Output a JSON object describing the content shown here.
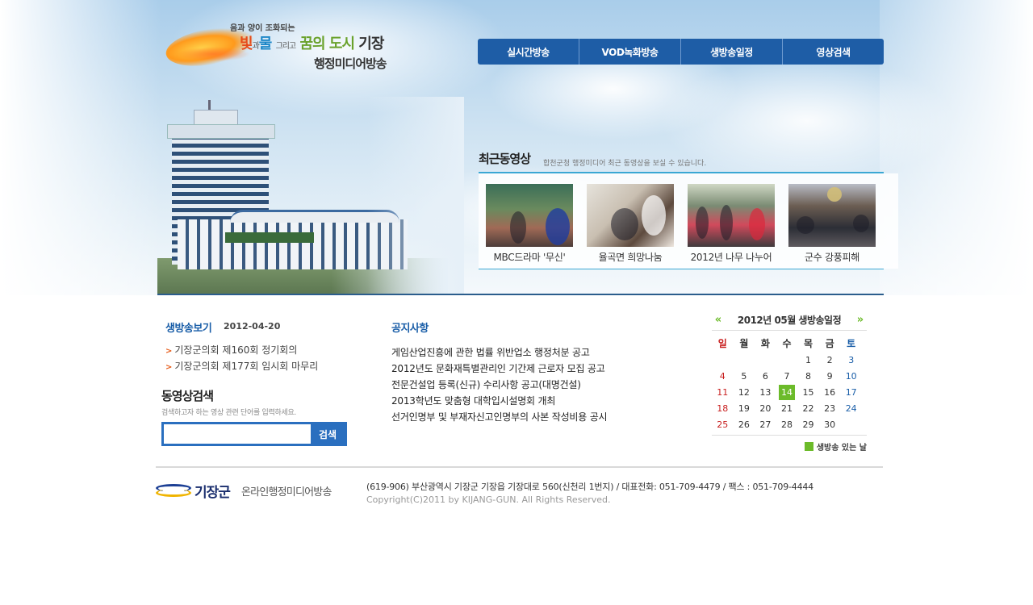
{
  "logo": {
    "tagline": "음과 양이 조화되는",
    "title_part1": "빛",
    "title_part2": "과",
    "title_part3": "물",
    "title_part4": "그리고",
    "title_part5": "꿈의 도시",
    "title_part6": "기장",
    "subtitle": "행정미디어방송"
  },
  "topnav": {
    "items": [
      "실시간방송",
      "VOD녹화방송",
      "생방송일정",
      "영상검색"
    ]
  },
  "recent": {
    "title": "최근동영상",
    "description": "합천군청 행정미디어 최근 동영상을 보실 수 있습니다.",
    "videos": [
      {
        "caption": "MBC드라마 '무신'"
      },
      {
        "caption": "율곡면 희망나눔"
      },
      {
        "caption": "2012년 나무 나누어"
      },
      {
        "caption": "군수 강풍피해"
      }
    ]
  },
  "live": {
    "title": "생방송보기",
    "date": "2012-04-20",
    "items": [
      "기장군의회 제160회 정기회의",
      "기장군의회 제177회 임시회 마무리"
    ]
  },
  "search": {
    "title": "동영상검색",
    "description": "검색하고자 하는 영상 관련 단어를 입력하세요.",
    "input_value": "",
    "button_label": "검색"
  },
  "notice": {
    "title": "공지사항",
    "items": [
      "게임산업진흥에 관한 법률 위반업소 행정처분 공고",
      "2012년도 문화재특별관리인 기간제 근로자 모집 공고",
      "전문건설업 등록(신규) 수리사항 공고(대명건설)",
      "2013학년도 맞춤형 대학입시설명회 개최",
      "선거인명부 및 부재자신고인명부의 사본 작성비용 공시"
    ]
  },
  "calendar": {
    "prev_icon": "«",
    "next_icon": "»",
    "title": "2012년 05월 생방송일정",
    "weekdays": [
      "일",
      "월",
      "화",
      "수",
      "목",
      "금",
      "토"
    ],
    "weeks": [
      [
        "",
        "",
        "",
        "",
        "1",
        "2",
        "3"
      ],
      [
        "4",
        "5",
        "6",
        "7",
        "8",
        "9",
        "10"
      ],
      [
        "11",
        "12",
        "13",
        "14",
        "15",
        "16",
        "17"
      ],
      [
        "18",
        "19",
        "20",
        "21",
        "22",
        "23",
        "24"
      ],
      [
        "25",
        "26",
        "27",
        "28",
        "29",
        "30",
        ""
      ]
    ],
    "live_days": [
      "14"
    ],
    "legend": "생방송 있는 날",
    "accent_color": "#6cbb2a"
  },
  "footer": {
    "logo_name": "기장군",
    "logo_sub": "온라인행정미디어방송",
    "address": "(619-906) 부산광역시 기장군 기장읍 기장대로 560(신천리 1번지)  /  대표전화: 051-709-4479  /  팩스 : 051-709-4444",
    "copyright": "Copyright(C)2011 by KIJANG-GUN. All Rights Reserved."
  }
}
